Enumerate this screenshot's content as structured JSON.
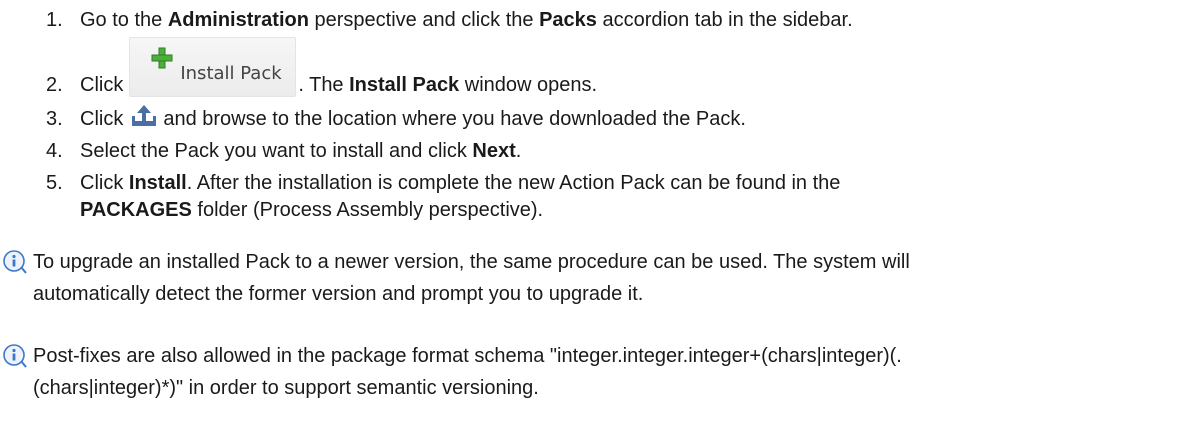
{
  "steps": [
    {
      "number": "1.",
      "parts": [
        "Go to the ",
        "Administration",
        " perspective and click the ",
        "Packs",
        " accordion tab in the sidebar."
      ]
    },
    {
      "number": "2.",
      "before": "Click",
      "button_label": "Install Pack",
      "after_a": ". The ",
      "after_bold": "Install Pack",
      "after_b": " window opens."
    },
    {
      "number": "3.",
      "before": "Click",
      "after": "and browse to the location where you have downloaded the Pack."
    },
    {
      "number": "4.",
      "text": "Select the Pack you want to install and click ",
      "bold": "Next",
      "end": "."
    },
    {
      "number": "5.",
      "text_a": "Click ",
      "bold_a": "Install",
      "text_b": ". After the installation is complete the new Action Pack can be found in the",
      "bold_b": "PACKAGES",
      "text_c": " folder (Process Assembly perspective)."
    }
  ],
  "notes": [
    {
      "line1": "To upgrade an installed Pack to a newer version, the same procedure can be used. The system will",
      "line2": "automatically detect the former version and prompt you to upgrade it."
    },
    {
      "line1": "Post-fixes are also allowed in the package format schema \"integer.integer.integer+(chars|integer)(.",
      "line2": "(chars|integer)*)\" in order to support semantic versioning."
    }
  ],
  "colors": {
    "plus_icon": "#4caf3c",
    "upload_icon": "#4a6fa5",
    "info_icon": "#3c78c8"
  }
}
